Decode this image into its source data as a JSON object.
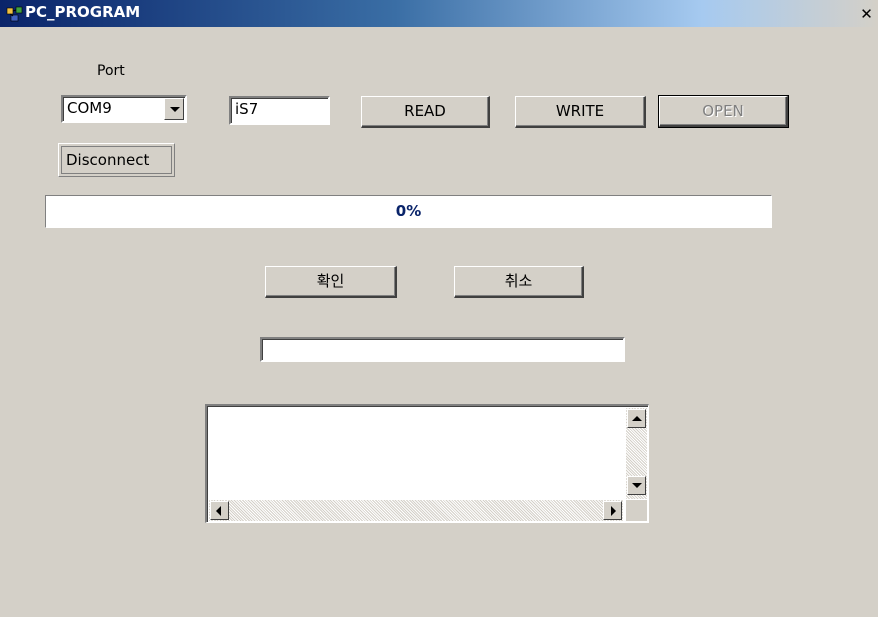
{
  "window": {
    "title": "PC_PROGRAM",
    "close_glyph": "✕",
    "icon": "app-icon"
  },
  "port": {
    "label": "Port",
    "selected": "COM9"
  },
  "model_field": {
    "value": "iS7"
  },
  "buttons": {
    "read": "READ",
    "write": "WRITE",
    "open": "OPEN",
    "confirm": "확인",
    "cancel": "취소"
  },
  "connection_status": "Disconnect",
  "progress": {
    "value": 0,
    "text": "0%"
  },
  "message_field": {
    "value": ""
  },
  "log_box": {
    "lines": []
  },
  "colors": {
    "titlebar_start": "#0a246a",
    "face": "#d4d0c8",
    "progress_text": "#0a246a"
  }
}
